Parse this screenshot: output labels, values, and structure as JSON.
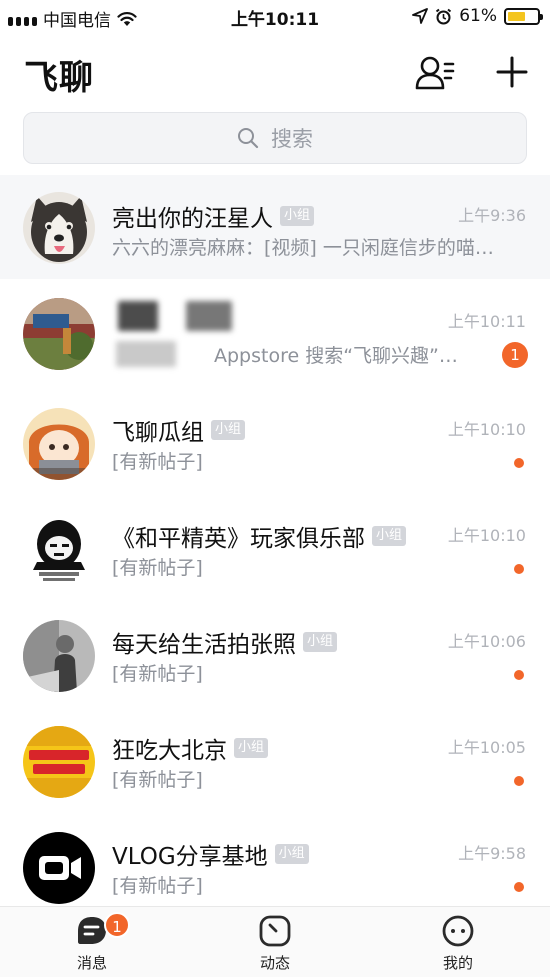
{
  "status_bar": {
    "carrier": "中国电信",
    "time": "上午10:11",
    "battery": "61%",
    "battery_level": 0.61
  },
  "header": {
    "title": "飞聊",
    "contacts_icon": "contacts-icon",
    "add_icon": "plus-icon"
  },
  "search": {
    "placeholder": "搜索"
  },
  "chats": [
    {
      "name": "亮出你的汪星人",
      "tag": "小组",
      "preview": "六六的漂亮麻麻：[视频] 一只闲庭信步的喵…",
      "time": "上午9:36",
      "pinned": true
    },
    {
      "name": "",
      "tag": "",
      "preview": "Appstore 搜索“飞聊兴趣”…",
      "time": "上午10:11",
      "unread_count": "1"
    },
    {
      "name": "飞聊瓜组",
      "tag": "小组",
      "preview": "[有新帖子]",
      "time": "上午10:10",
      "unread_dot": true
    },
    {
      "name": "《和平精英》玩家俱乐部",
      "tag": "小组",
      "preview": "[有新帖子]",
      "time": "上午10:10",
      "unread_dot": true
    },
    {
      "name": "每天给生活拍张照",
      "tag": "小组",
      "preview": "[有新帖子]",
      "time": "上午10:06",
      "unread_dot": true
    },
    {
      "name": "狂吃大北京",
      "tag": "小组",
      "preview": "[有新帖子]",
      "time": "上午10:05",
      "unread_dot": true
    },
    {
      "name": "VLOG分享基地",
      "tag": "小组",
      "preview": "[有新帖子]",
      "time": "上午9:58",
      "unread_dot": true
    }
  ],
  "tab_bar": {
    "tabs": [
      {
        "label": "消息",
        "icon": "message-icon",
        "badge": "1"
      },
      {
        "label": "动态",
        "icon": "moments-icon"
      },
      {
        "label": "我的",
        "icon": "profile-icon"
      }
    ]
  },
  "colors": {
    "accent": "#f2662a",
    "tag_bg": "#d3d5da",
    "pinned_bg": "#f6f7f9"
  }
}
